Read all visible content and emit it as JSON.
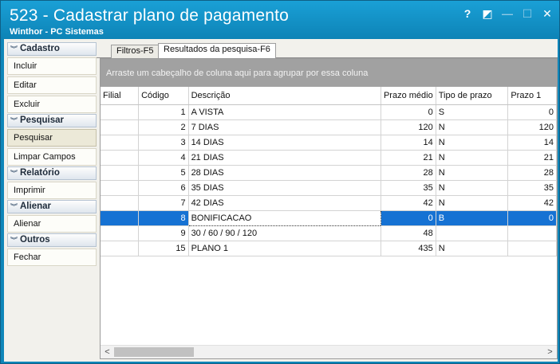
{
  "window": {
    "title": "523 - Cadastrar plano de pagamento",
    "subtitle": "Winthor - PC Sistemas",
    "controls": {
      "help": "?",
      "restore": "◩",
      "minimize": "—",
      "maximize": "☐",
      "close": "✕"
    }
  },
  "sidebar": {
    "groups": [
      {
        "label": "Cadastro",
        "items": [
          "Incluir",
          "Editar",
          "Excluir"
        ]
      },
      {
        "label": "Pesquisar",
        "items": [
          "Pesquisar",
          "Limpar Campos"
        ]
      },
      {
        "label": "Relatório",
        "items": [
          "Imprimir"
        ]
      },
      {
        "label": "Alienar",
        "items": [
          "Alienar"
        ]
      },
      {
        "label": "Outros",
        "items": [
          "Fechar"
        ]
      }
    ],
    "chevron": "chevron-double-down-icon"
  },
  "tabs": [
    {
      "label": "Filtros-F5",
      "selected": false
    },
    {
      "label": "Resultados da pesquisa-F6",
      "selected": true
    }
  ],
  "grid": {
    "group_hint": "Arraste um cabeçalho de coluna aqui para agrupar por essa coluna",
    "columns": [
      "Filial",
      "Código",
      "Descrição",
      "Prazo médio",
      "Tipo de prazo",
      "Prazo 1"
    ],
    "rows": [
      [
        "",
        "1",
        "A VISTA",
        "0",
        "S",
        "0"
      ],
      [
        "",
        "2",
        "7 DIAS",
        "120",
        "N",
        "120"
      ],
      [
        "",
        "3",
        "14 DIAS",
        "14",
        "N",
        "14"
      ],
      [
        "",
        "4",
        "21 DIAS",
        "21",
        "N",
        "21"
      ],
      [
        "",
        "5",
        "28 DIAS",
        "28",
        "N",
        "28"
      ],
      [
        "",
        "6",
        "35 DIAS",
        "35",
        "N",
        "35"
      ],
      [
        "",
        "7",
        "42 DIAS",
        "42",
        "N",
        "42"
      ],
      [
        "",
        "8",
        "BONIFICACAO",
        "0",
        "B",
        "0"
      ],
      [
        "",
        "9",
        "30 / 60 / 90 / 120",
        "48",
        "",
        ""
      ],
      [
        "",
        "15",
        "PLANO 1",
        "435",
        "N",
        ""
      ]
    ],
    "selected_row": 7,
    "scroll": {
      "left": "<",
      "right": ">"
    }
  },
  "colors": {
    "title_bar": "#1aa0d6",
    "selection": "#1672d3",
    "group_bar": "#a1a1a1"
  }
}
